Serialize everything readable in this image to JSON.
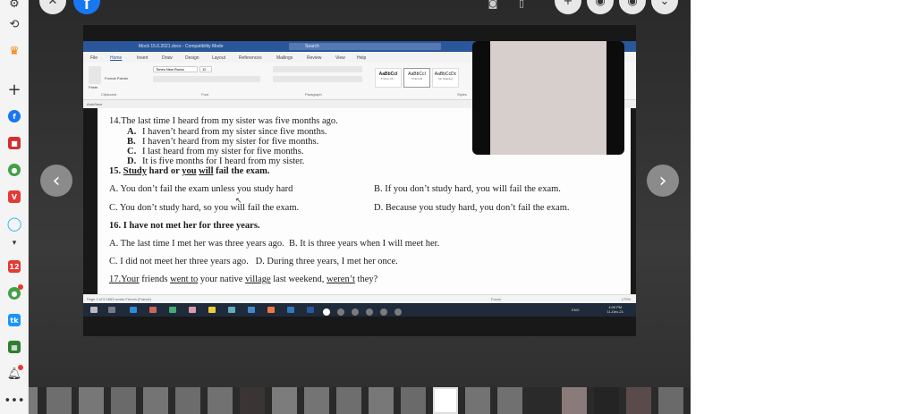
{
  "document": {
    "lines": [
      "14.The last time I heard from my sister was five months ago.",
      "I haven’t heard from my sister since five months.",
      "I haven’t heard from my sister for five months.",
      "I last heard from my sister for five months.",
      "It is five months for I heard from my sister.",
      "A. You don’t fail the exam unless you study hard",
      "B. If you don’t study hard, you will fail the exam.",
      "C. You don’t study hard, so you will fail the exam.",
      "D. Because you study hard, you don’t fail the exam.",
      "16. I have not met her for three years.",
      "A. The last time I met her was three years ago.  B. It is three years when I will meet her.",
      "C. I did not meet her three years ago.   D. During three years, I met her once."
    ],
    "q14_letters": [
      "A.",
      "B.",
      "C.",
      "D."
    ],
    "q15": {
      "num": "15.",
      "w1": "Study",
      "t1": " hard or ",
      "w2": "you",
      "t2": " ",
      "w3": "will",
      "t3": " fail the exam."
    },
    "q17": {
      "w1": "17.Your",
      "t1": " friends ",
      "w2": "went to",
      "t2": " your native ",
      "w3": "village",
      "t3": " last weekend, ",
      "w4": "weren’t",
      "t4": " they?"
    }
  },
  "word_ui": {
    "title": "Mock 15.6.2021.docx - Compatibility Mode",
    "search": "Search",
    "tabs": [
      "File",
      "Home",
      "Insert",
      "Draw",
      "Design",
      "Layout",
      "References",
      "Mailings",
      "Review",
      "View",
      "Help"
    ],
    "font_name": "Times New Roma",
    "font_size": "12",
    "styles": [
      "AaBbCcI",
      "AaBbCcI",
      "AaBbCcDc"
    ],
    "style_names": [
      "¶ Char Ch...",
      "¶ Normal",
      "No Spacing"
    ],
    "group_labels": [
      "Clipboard",
      "Font",
      "Paragraph",
      "Styles"
    ],
    "paste": "Paste",
    "format_painter": "Format Painter",
    "autosave": "AutoSave",
    "status_left": "Page 2 of 5    1663 words    French (France)",
    "status_right": "Focus",
    "zoom": "170%",
    "clock_time": "4:09 PM",
    "clock_date": "11-Dec-21",
    "lang": "ENG"
  },
  "colors": {
    "word_blue": "#2b579a",
    "facebook_blue": "#1877f2"
  }
}
